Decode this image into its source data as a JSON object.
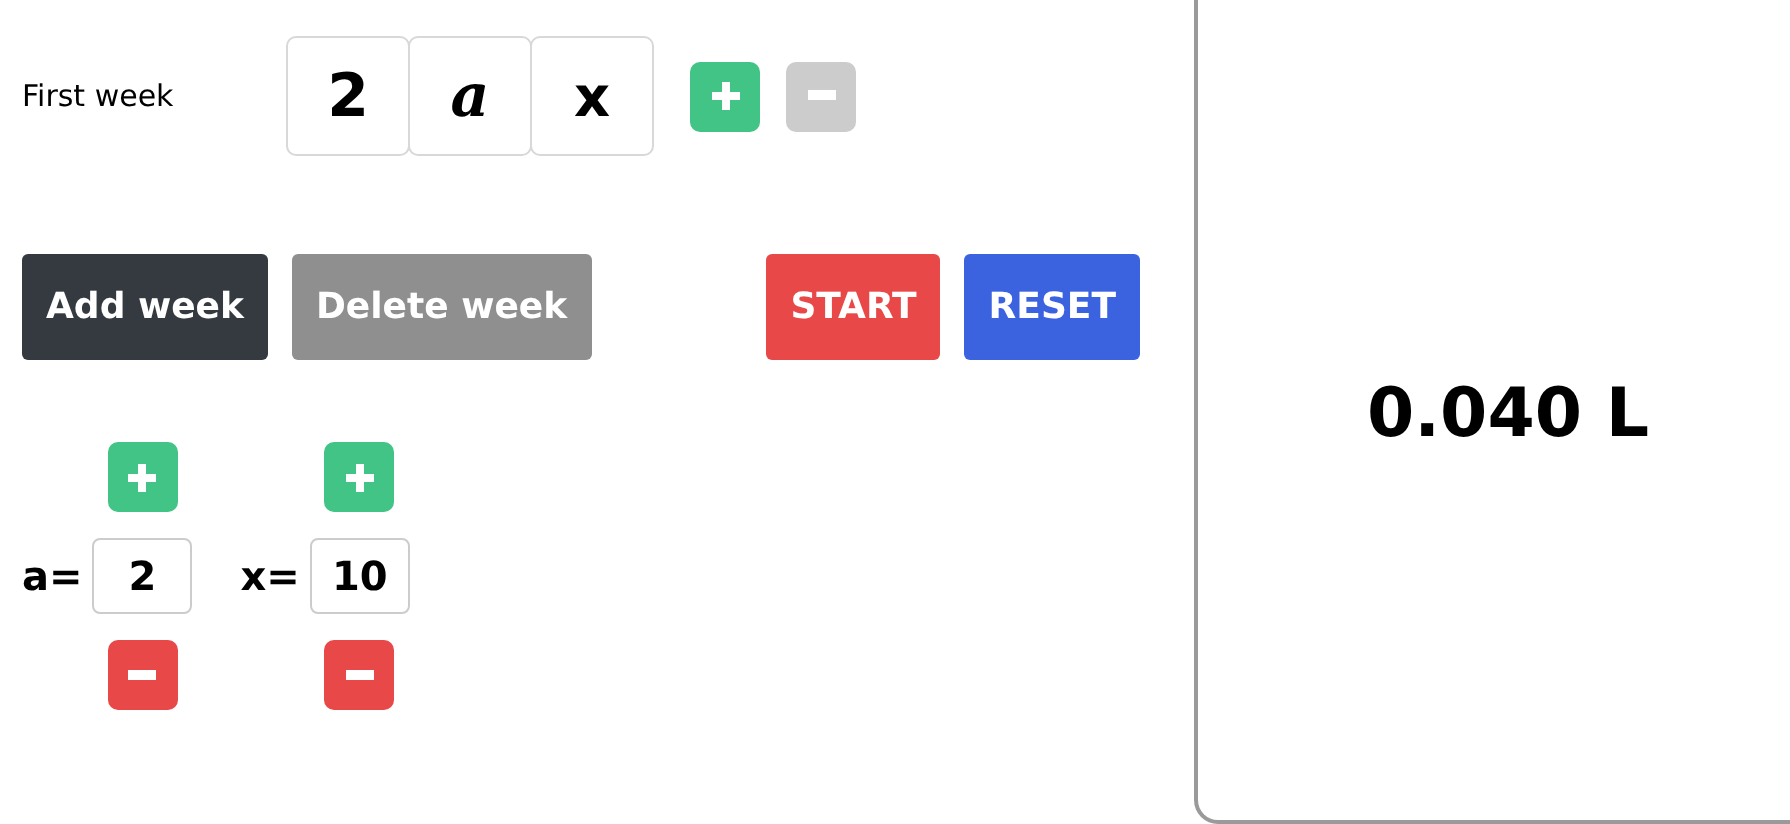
{
  "weeks": [
    {
      "label": "First week",
      "terms": [
        {
          "text": "2",
          "kind": "number"
        },
        {
          "text": "a",
          "kind": "symbol"
        },
        {
          "text": "x",
          "kind": "variable"
        }
      ],
      "add_term": {
        "disabled": false
      },
      "remove_term": {
        "disabled": true
      }
    }
  ],
  "actions": [
    {
      "label": "Add week",
      "kind": "neutral",
      "disabled": false
    },
    {
      "label": "Delete week",
      "kind": "neutral",
      "disabled": true
    },
    {
      "label": "START",
      "kind": "danger",
      "disabled": false
    },
    {
      "label": "RESET",
      "kind": "primary",
      "disabled": false
    }
  ],
  "parameters": [
    {
      "label": "a=",
      "value": "2"
    },
    {
      "label": "x=",
      "value": "10"
    }
  ],
  "result": "0.040 L"
}
